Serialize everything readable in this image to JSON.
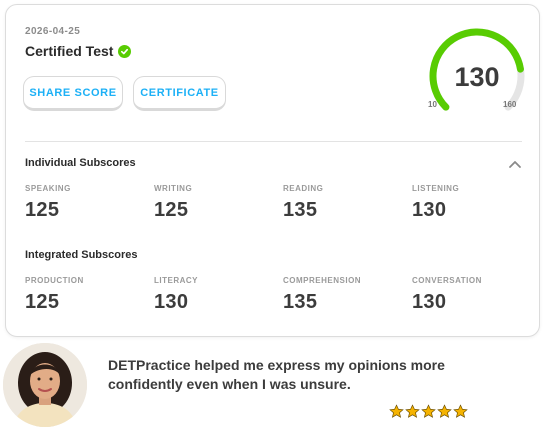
{
  "result": {
    "date": "2026-04-25",
    "title": "Certified Test",
    "share_label": "SHARE SCORE",
    "certificate_label": "CERTIFICATE"
  },
  "gauge": {
    "score": "130",
    "min": "10",
    "max": "160",
    "accent": "#58cc02",
    "track": "#e5e5e5"
  },
  "individual": {
    "title": "Individual Subscores",
    "items": [
      {
        "label": "SPEAKING",
        "value": "125"
      },
      {
        "label": "WRITING",
        "value": "125"
      },
      {
        "label": "READING",
        "value": "135"
      },
      {
        "label": "LISTENING",
        "value": "130"
      }
    ]
  },
  "integrated": {
    "title": "Integrated Subscores",
    "items": [
      {
        "label": "PRODUCTION",
        "value": "125"
      },
      {
        "label": "LITERACY",
        "value": "130"
      },
      {
        "label": "COMPREHENSION",
        "value": "135"
      },
      {
        "label": "CONVERSATION",
        "value": "130"
      }
    ]
  },
  "testimonial": {
    "quote": "DETPractice helped me express my opinions more confidently even when I was unsure.",
    "rating": 5
  },
  "colors": {
    "link_blue": "#1cb0f6",
    "check_green": "#58cc02",
    "star_gold": "#f5b301"
  }
}
